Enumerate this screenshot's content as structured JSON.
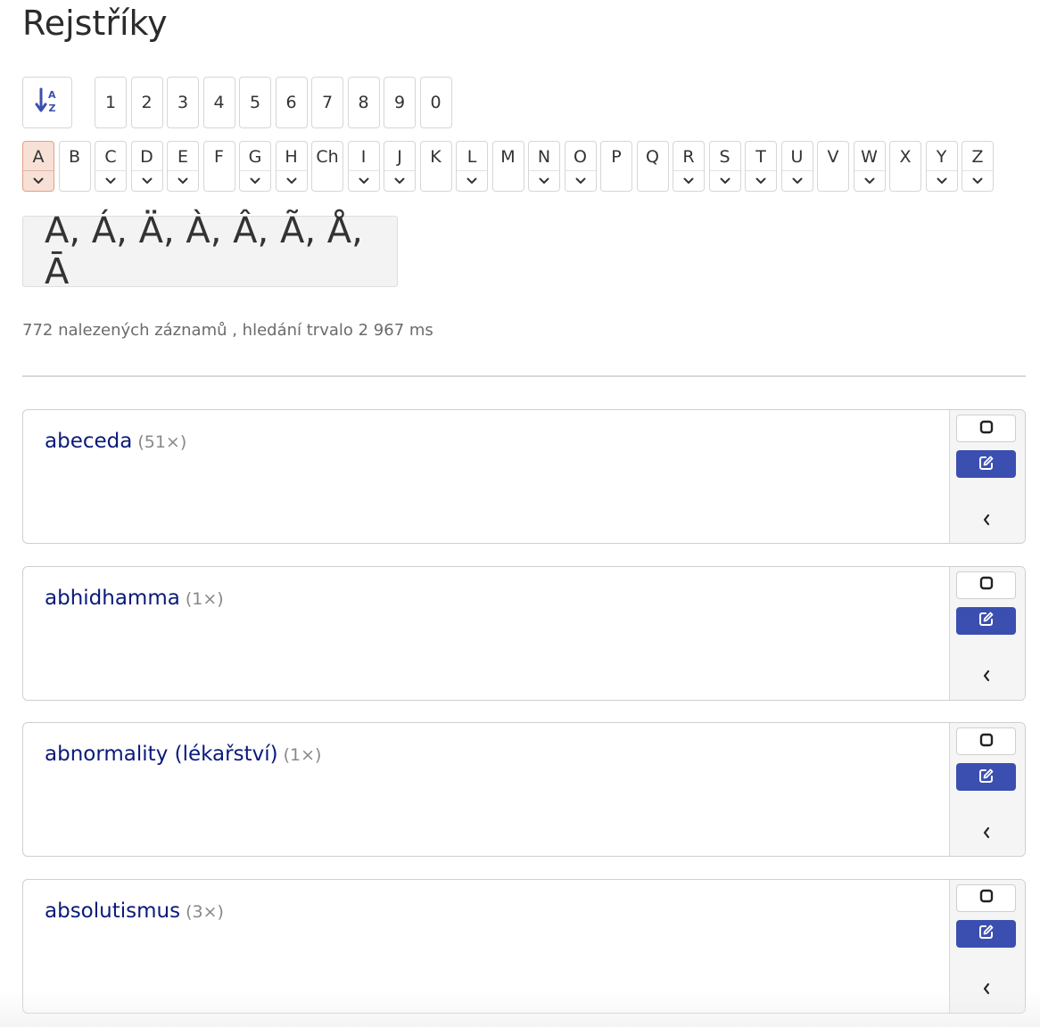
{
  "page": {
    "title": "Rejstříky"
  },
  "sort": {
    "icon": "sort-alpha-down-icon"
  },
  "digits": [
    "1",
    "2",
    "3",
    "4",
    "5",
    "6",
    "7",
    "8",
    "9",
    "0"
  ],
  "letters": [
    {
      "label": "A",
      "dropdown": true,
      "active": true
    },
    {
      "label": "B",
      "dropdown": false
    },
    {
      "label": "C",
      "dropdown": true
    },
    {
      "label": "D",
      "dropdown": true
    },
    {
      "label": "E",
      "dropdown": true
    },
    {
      "label": "F",
      "dropdown": false
    },
    {
      "label": "G",
      "dropdown": true
    },
    {
      "label": "H",
      "dropdown": true
    },
    {
      "label": "Ch",
      "dropdown": false
    },
    {
      "label": "I",
      "dropdown": true
    },
    {
      "label": "J",
      "dropdown": true
    },
    {
      "label": "K",
      "dropdown": false
    },
    {
      "label": "L",
      "dropdown": true
    },
    {
      "label": "M",
      "dropdown": false
    },
    {
      "label": "N",
      "dropdown": true
    },
    {
      "label": "O",
      "dropdown": true
    },
    {
      "label": "P",
      "dropdown": false
    },
    {
      "label": "Q",
      "dropdown": false
    },
    {
      "label": "R",
      "dropdown": true
    },
    {
      "label": "S",
      "dropdown": true
    },
    {
      "label": "T",
      "dropdown": true
    },
    {
      "label": "U",
      "dropdown": true
    },
    {
      "label": "V",
      "dropdown": false
    },
    {
      "label": "W",
      "dropdown": true
    },
    {
      "label": "X",
      "dropdown": false
    },
    {
      "label": "Y",
      "dropdown": true
    },
    {
      "label": "Z",
      "dropdown": true
    }
  ],
  "variants": {
    "text": "A, Á, Ä, À, Â, Ã, Å, Ā"
  },
  "results": {
    "summary": "772 nalezených záznamů , hledání trvalo 2 967 ms"
  },
  "entries": [
    {
      "term": "abeceda",
      "count": "(51×)"
    },
    {
      "term": "abhidhamma",
      "count": "(1×)"
    },
    {
      "term": "abnormality (lékařství)",
      "count": "(1×)"
    },
    {
      "term": "absolutismus",
      "count": "(3×)"
    }
  ],
  "icons": {
    "checkbox": "square-icon",
    "edit": "edit-icon",
    "expand": "chevron-left-icon"
  },
  "colors": {
    "link": "#0a1a7a",
    "edit_button": "#3b4fb0",
    "active_letter_bg": "#f7e0d6",
    "active_letter_border": "#e0a08a"
  }
}
